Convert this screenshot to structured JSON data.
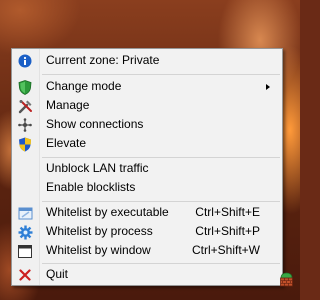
{
  "menu": {
    "items": [
      {
        "label": "Current zone: Private",
        "icon": "info-icon"
      },
      {
        "label": "Change mode",
        "icon": "shield-icon",
        "submenu": true
      },
      {
        "label": "Manage",
        "icon": "tools-icon"
      },
      {
        "label": "Show connections",
        "icon": "network-icon"
      },
      {
        "label": "Elevate",
        "icon": "uac-shield-icon"
      },
      {
        "label": "Unblock LAN traffic"
      },
      {
        "label": "Enable blocklists"
      },
      {
        "label": "Whitelist by executable",
        "icon": "executable-icon",
        "shortcut": "Ctrl+Shift+E"
      },
      {
        "label": "Whitelist by process",
        "icon": "gear-icon",
        "shortcut": "Ctrl+Shift+P"
      },
      {
        "label": "Whitelist by window",
        "icon": "window-icon",
        "shortcut": "Ctrl+Shift+W"
      },
      {
        "label": "Quit",
        "icon": "close-icon"
      }
    ]
  },
  "tray": {
    "icon": "firewall-tray-icon"
  },
  "colors": {
    "menu_bg": "#f2f2f2",
    "menu_border": "#979797",
    "info_blue": "#1a5fc6",
    "quit_red": "#cc1f1f"
  }
}
